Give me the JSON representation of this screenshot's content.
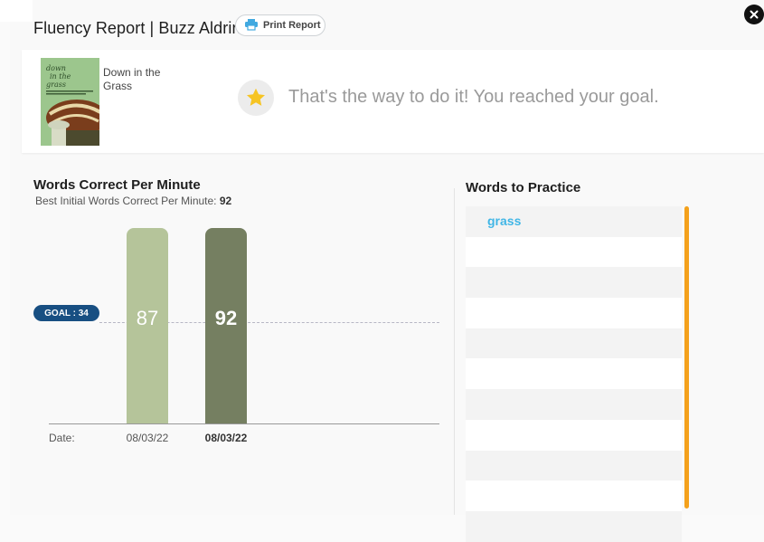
{
  "header": {
    "title": "Fluency Report | Buzz Aldrin",
    "print_label": "Print Report"
  },
  "book": {
    "title": "Down in the Grass",
    "cover_text": "down in the grass"
  },
  "message": {
    "text": "That's the way to do it! You reached your goal.",
    "icon": "star-icon"
  },
  "wcpm": {
    "title": "Words Correct Per Minute",
    "subtitle_label": "Best Initial Words Correct Per Minute:",
    "subtitle_value": "92"
  },
  "chart_data": {
    "type": "bar",
    "categories": [
      "08/03/22",
      "08/03/22"
    ],
    "values": [
      87,
      92
    ],
    "goal": 34,
    "goal_label": "GOAL : 34",
    "x_axis_prefix": "Date:",
    "colors": [
      "#b5c49a",
      "#757f61"
    ]
  },
  "words_to_practice": {
    "title": "Words to Practice",
    "words": [
      "grass",
      "",
      "",
      "",
      "",
      "",
      "",
      "",
      "",
      "",
      ""
    ]
  },
  "colors": {
    "accent_orange": "#f4a11c",
    "goal_blue": "#184f82",
    "word_blue": "#41b6e6",
    "print_icon_blue": "#41a9e0"
  }
}
